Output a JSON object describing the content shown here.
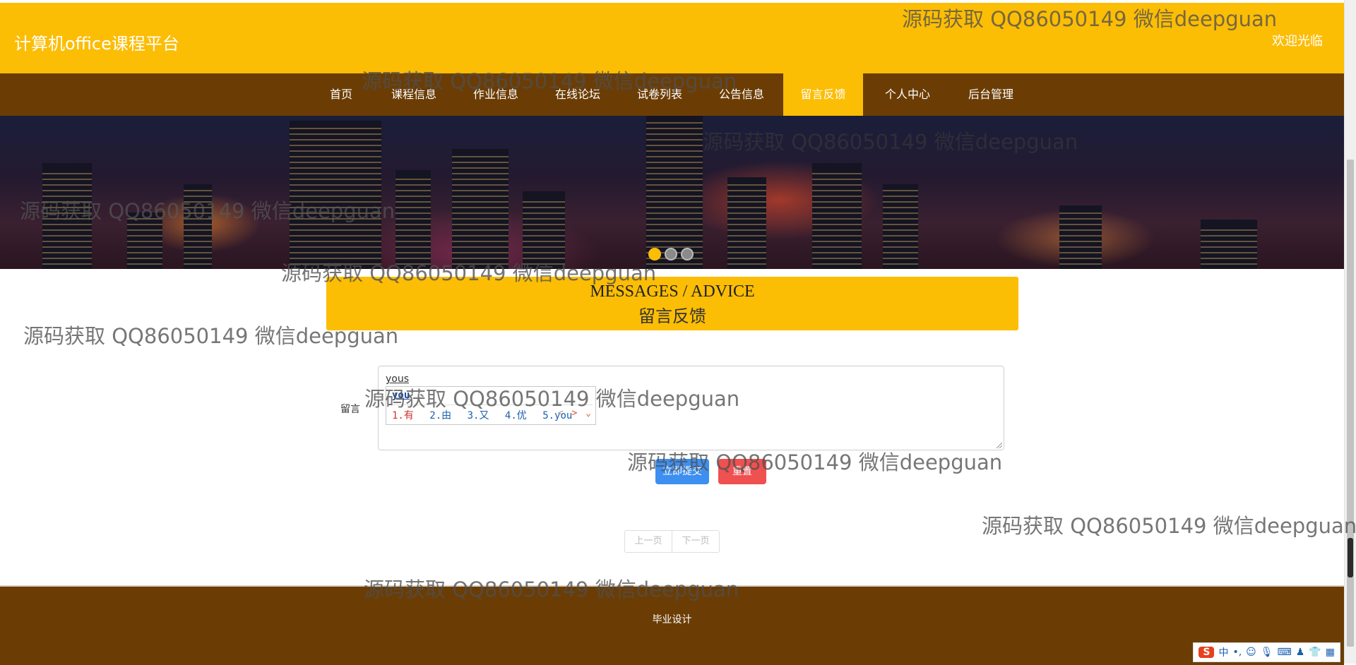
{
  "header": {
    "title": "计算机office课程平台",
    "welcome": "欢迎光临"
  },
  "nav": {
    "items": [
      "首页",
      "课程信息",
      "作业信息",
      "在线论坛",
      "试卷列表",
      "公告信息",
      "留言反馈",
      "个人中心",
      "后台管理"
    ],
    "active": "留言反馈"
  },
  "carousel": {
    "slides": 3,
    "active_index": 0
  },
  "section": {
    "title_en": "MESSAGES / ADVICE",
    "title_cn": "留言反馈"
  },
  "form": {
    "label": "留言",
    "value": "yous",
    "submit_label": "立即提交",
    "reset_label": "重置"
  },
  "ime_popup": {
    "composition": "you",
    "candidates": [
      "1.有",
      "2.由",
      "3.又",
      "4.优",
      "5.you"
    ],
    "prev": "<",
    "next": ">",
    "expand": "⌄"
  },
  "pager": {
    "prev": "上一页",
    "next": "下一页"
  },
  "footer": {
    "text": "毕业设计"
  },
  "ime_toolbar": {
    "logo": "S",
    "lang": "中",
    "punct": "•,",
    "icons": [
      "emoji-icon",
      "mic-icon",
      "keyboard-icon",
      "skin-icon",
      "tools-icon",
      "grid-icon"
    ]
  },
  "watermark": "源码获取 QQ86050149 微信deepguan",
  "colors": {
    "brand_yellow": "#fcbd05",
    "brand_brown": "#6b3d05",
    "submit": "#3d8ff0",
    "reset": "#ef5050"
  }
}
